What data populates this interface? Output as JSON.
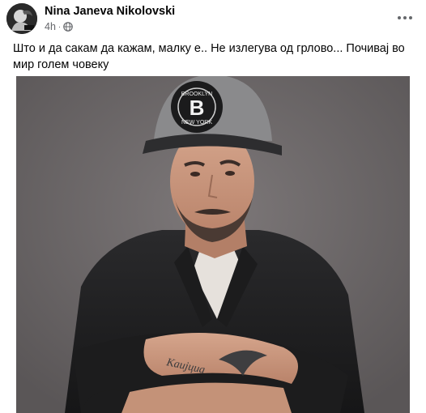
{
  "post": {
    "author": "Nina Janeva Nikolovski",
    "timestamp": "4h",
    "separator": "·",
    "privacy_icon": "globe-icon",
    "more_icon": "more-options-icon",
    "caption": "Што и да сакам да кажам, малку е.. Не излегува од грлово... Почивај во мир голем човеку"
  },
  "photo": {
    "cap_text_top": "BROOKLYN",
    "cap_text_bottom": "NEW YORK",
    "cap_letter": "B",
    "tattoo_text": "Каијциа"
  },
  "colors": {
    "photo_background": "#6e6a6b",
    "text_primary": "#050505",
    "text_secondary": "#65676b"
  }
}
